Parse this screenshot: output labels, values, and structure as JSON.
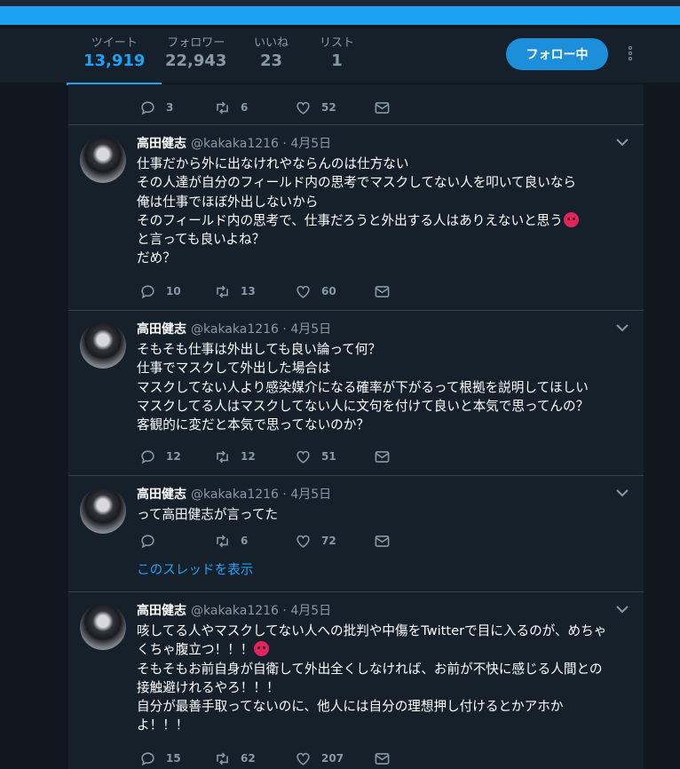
{
  "profile_nav": {
    "stats": [
      {
        "label": "ツイート",
        "value": "13,919"
      },
      {
        "label": "フォロワー",
        "value": "22,943"
      },
      {
        "label": "いいね",
        "value": "23"
      },
      {
        "label": "リスト",
        "value": "1"
      }
    ],
    "follow_button": "フォロー中"
  },
  "colors": {
    "accent": "#1da1f2",
    "background": "#15202b",
    "muted": "#8899a6",
    "emoji": "#e0245e"
  },
  "tweets": [
    {
      "actions": {
        "reply": "3",
        "retweet": "6",
        "like": "52"
      }
    },
    {
      "name": "高田健志",
      "handle": "@kakaka1216",
      "dot": "·",
      "date": "4月5日",
      "lines": [
        "仕事だから外に出なけれやならんのは仕方ない",
        "その人達が自分のフィールド内の思考でマスクしてない人を叩いて良いなら",
        "俺は仕事でほぼ外出しないから",
        "そのフィールド内の思考で、仕事だろうと外出する人はありえないと思う",
        "と言っても良いよね？",
        "だめ？"
      ],
      "emoji": "angry-face-icon",
      "actions": {
        "reply": "10",
        "retweet": "13",
        "like": "60"
      }
    },
    {
      "name": "高田健志",
      "handle": "@kakaka1216",
      "dot": "·",
      "date": "4月5日",
      "lines": [
        "そもそも仕事は外出しても良い論って何？",
        "仕事でマスクして外出した場合は",
        "マスクしてない人より感染媒介になる確率が下がるって根拠を説明してほしい",
        "マスクしてる人はマスクしてない人に文句を付けて良いと本気で思ってんの？",
        "客観的に変だと本気で思ってないのか？"
      ],
      "actions": {
        "reply": "12",
        "retweet": "12",
        "like": "51"
      }
    },
    {
      "name": "高田健志",
      "handle": "@kakaka1216",
      "dot": "·",
      "date": "4月5日",
      "lines": [
        "って高田健志が言ってた"
      ],
      "actions": {
        "reply": "",
        "retweet": "6",
        "like": "72"
      },
      "thread_link": "このスレッドを表示"
    },
    {
      "name": "高田健志",
      "handle": "@kakaka1216",
      "dot": "·",
      "date": "4月5日",
      "lines": [
        "咳してる人やマスクしてない人への批判や中傷をTwitterで目に入るのが、めちゃ",
        "くちゃ腹立つ！！！",
        "そもそもお前自身が自衛して外出全くしなければ、お前が不快に感じる人間との",
        "接触避けれるやろ！！！",
        "自分が最善手取ってないのに、他人には自分の理想押し付けるとかアホか",
        "よ！！！"
      ],
      "emoji": "angry-face-icon",
      "actions": {
        "reply": "15",
        "retweet": "62",
        "like": "207"
      }
    }
  ]
}
